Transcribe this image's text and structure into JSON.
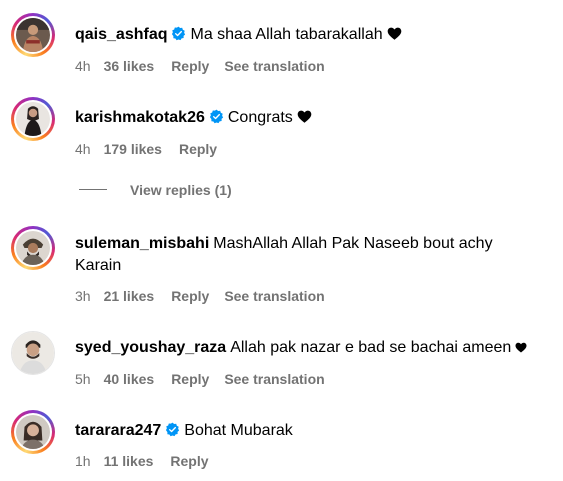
{
  "colors": {
    "text": "#000000",
    "secondary": "#737373",
    "verified_badge": "#0095f6",
    "heart": "#000000"
  },
  "comments": [
    {
      "username": "qais_ashfaq",
      "verified": true,
      "text": "Ma shaa Allah tabarakallah",
      "heart_emoji": true,
      "time": "4h",
      "likes": "36 likes",
      "reply": "Reply",
      "translation": "See translation",
      "avatar_icon": "profile-photo"
    },
    {
      "username": "karishmakotak26",
      "verified": true,
      "text": "Congrats",
      "heart_emoji": true,
      "time": "4h",
      "likes": "179 likes",
      "reply": "Reply",
      "avatar_icon": "profile-photo"
    },
    {
      "username": "suleman_misbahi",
      "verified": false,
      "text": "MashAllah Allah Pak Naseeb bout achy Karain",
      "time": "3h",
      "likes": "21 likes",
      "reply": "Reply",
      "translation": "See translation",
      "avatar_icon": "profile-photo"
    },
    {
      "username": "syed_youshay_raza",
      "verified": false,
      "text": "Allah pak nazar e bad se bachai ameen",
      "heart_emoji": true,
      "time": "5h",
      "likes": "40 likes",
      "reply": "Reply",
      "translation": "See translation",
      "avatar_icon": "profile-photo"
    },
    {
      "username": "tararara247",
      "verified": true,
      "text": "Bohat Mubarak",
      "time": "1h",
      "likes": "11 likes",
      "reply": "Reply",
      "avatar_icon": "profile-photo"
    }
  ],
  "view_replies": {
    "label": "View replies (1)"
  }
}
